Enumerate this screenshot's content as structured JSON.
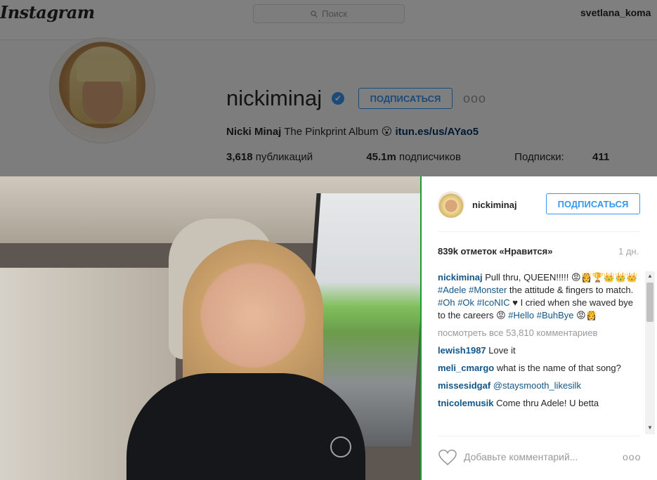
{
  "topnav": {
    "logo": "Instagram",
    "search_placeholder": "Поиск",
    "current_user": "svetlana_koma"
  },
  "profile": {
    "username": "nickiminaj",
    "verified_icon": "✔",
    "subscribe_label": "ПОДПИСАТЬСЯ",
    "more_icon": "ooo",
    "full_name": "Nicki Minaj",
    "bio_text": " The Pinkprint Album 😮 ",
    "bio_link": "itun.es/us/AYao5",
    "stats": {
      "posts_count": "3,618",
      "posts_label": " публикаций",
      "followers_count": "45.1m",
      "followers_label": " подписчиков",
      "following_label": "Подписки: ",
      "following_count": "411"
    }
  },
  "post": {
    "username": "nickiminaj",
    "subscribe_label": "ПОДПИСАТЬСЯ",
    "likes": "839k отметок «Нравится»",
    "age": "1 дн.",
    "caption": {
      "user": "nickiminaj",
      "part1": " Pull thru, QUEEN!!!!! 😡👸🏆👑👑👑 ",
      "tag1": "#Adele",
      "tag2": "#Monster",
      "part2": " the attitude & fingers to match. ",
      "tag3": "#Oh",
      "tag4": "#Ok",
      "tag5": "#IcoNIC",
      "part3": " ♥ I cried when she waved bye to the careers 😡 ",
      "tag6": "#Hello",
      "tag7": "#BuhBye",
      "part4": " 😡👸"
    },
    "view_all": "посмотреть все 53,810 комментариев",
    "comments": [
      {
        "user": "lewish1987",
        "text": " Love it"
      },
      {
        "user": "meli_cmargo",
        "text": " what is the name of that song?"
      },
      {
        "user": "missesidgaf",
        "text": " @staysmooth_likesilk"
      },
      {
        "user": "tnicolemusik",
        "text": " Come thru Adele! U betta"
      }
    ],
    "add_comment_placeholder": "Добавьте комментарий...",
    "more_icon": "ooo"
  },
  "icons": {
    "heart": "heart-icon",
    "search": "search-icon",
    "verified": "verified-badge-icon"
  }
}
